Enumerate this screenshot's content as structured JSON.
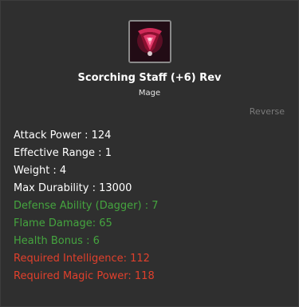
{
  "item": {
    "name": "Scorching Staff (+6) Rev",
    "class": "Mage",
    "reverse_label": "Reverse",
    "icon": "staff-icon",
    "stats": [
      {
        "text": "Attack Power : 124",
        "color": "white"
      },
      {
        "text": "Effective Range : 1",
        "color": "white"
      },
      {
        "text": "Weight : 4",
        "color": "white"
      },
      {
        "text": "Max Durability : 13000",
        "color": "white"
      },
      {
        "text": "Defense Ability (Dagger) : 7",
        "color": "green"
      },
      {
        "text": "Flame Damage: 65",
        "color": "green"
      },
      {
        "text": "Health Bonus : 6",
        "color": "green"
      },
      {
        "text": "Required Intelligence: 112",
        "color": "red"
      },
      {
        "text": "Required Magic Power: 118",
        "color": "red"
      }
    ]
  },
  "colors": {
    "background": "#2f2f2f",
    "white": "#ffffff",
    "green": "#45a53f",
    "red": "#e0402c",
    "muted": "#7b7b7b"
  }
}
